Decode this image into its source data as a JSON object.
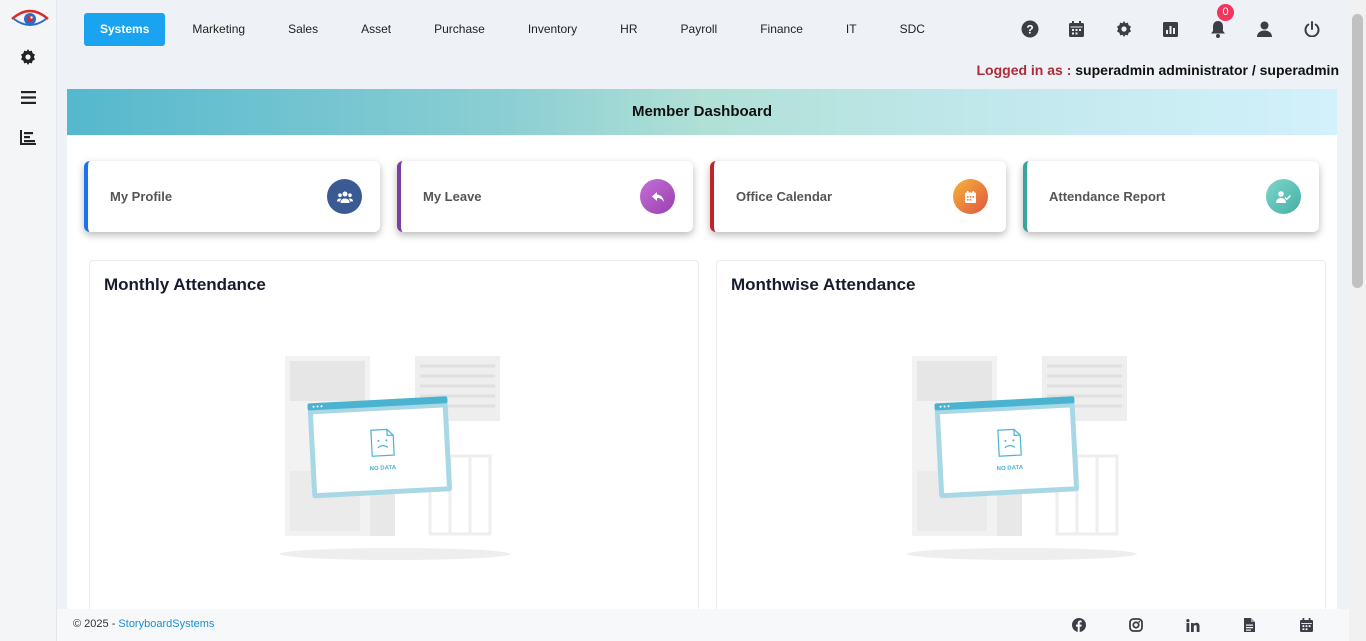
{
  "nav": {
    "items": [
      {
        "label": "Systems",
        "active": true
      },
      {
        "label": "Marketing"
      },
      {
        "label": "Sales"
      },
      {
        "label": "Asset"
      },
      {
        "label": "Purchase"
      },
      {
        "label": "Inventory"
      },
      {
        "label": "HR"
      },
      {
        "label": "Payroll"
      },
      {
        "label": "Finance"
      },
      {
        "label": "IT"
      },
      {
        "label": "SDC"
      }
    ],
    "active_color": "#1aa3f0"
  },
  "toolbar": {
    "icons": [
      "help-icon",
      "calendar-icon",
      "settings-icon",
      "report-icon",
      "bell-icon",
      "user-icon",
      "power-icon"
    ],
    "notification_count": "0"
  },
  "sidebar": {
    "icons": [
      "eye-logo",
      "gear-icon",
      "menu-icon",
      "chart-icon"
    ]
  },
  "session": {
    "label": "Logged in as :",
    "user": "superadmin administrator / superadmin"
  },
  "dashboard": {
    "title": "Member Dashboard",
    "cards": [
      {
        "label": "My Profile",
        "icon": "users-icon",
        "accent": "#1a73e8",
        "icon_bg": "#3a5a93"
      },
      {
        "label": "My Leave",
        "icon": "reply-icon",
        "accent": "#7a3fa0",
        "icon_bg": "#b055c4"
      },
      {
        "label": "Office Calendar",
        "icon": "calendar-icon",
        "accent": "#c0232b",
        "icon_bg": "#ef7d3a"
      },
      {
        "label": "Attendance Report",
        "icon": "user-check-icon",
        "accent": "#3aa39a",
        "icon_bg": "#5fc9bd"
      }
    ],
    "panels": [
      {
        "title": "Monthly Attendance",
        "empty_text": "NO DATA"
      },
      {
        "title": "Monthwise Attendance",
        "empty_text": "NO DATA"
      }
    ]
  },
  "footer": {
    "copyright": "© 2025 - ",
    "company": "StoryboardSystems",
    "icons": [
      "facebook-icon",
      "instagram-icon",
      "linkedin-icon",
      "document-icon",
      "calendar-icon"
    ]
  }
}
